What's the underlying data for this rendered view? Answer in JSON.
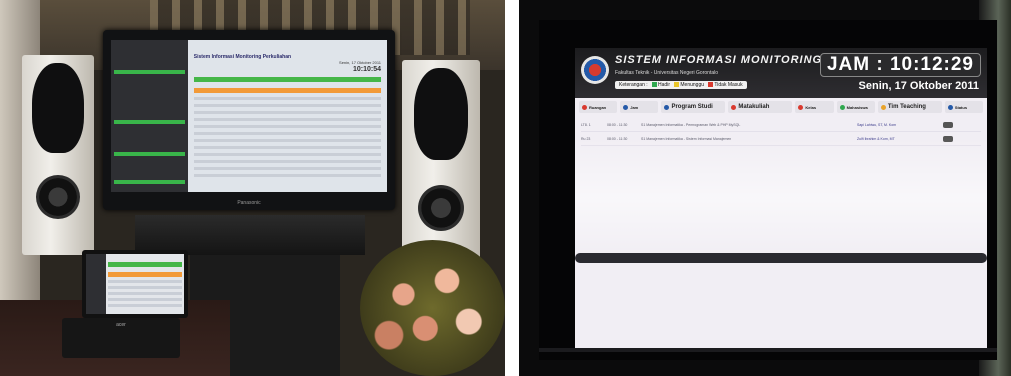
{
  "colors": {
    "header_dark": "#1c1c1e",
    "legend_green": "#2fa84f",
    "legend_yellow": "#e8c52a",
    "legend_red": "#d93a2f",
    "mini_green": "#39b54a",
    "mini_orange": "#f29a38"
  },
  "left_photo": {
    "tv": {
      "title": "Sistem Informasi Monitoring Perkuliahan",
      "date_text": "Senin, 17 Oktober 2011",
      "time": "10:10:54"
    },
    "tv_brand": "Panasonic",
    "laptop_brand": "acer"
  },
  "right_photo": {
    "app_title": "SISTEM INFORMASI MONITORING PERKULIAHAN",
    "app_subtitle": "Fakultas Teknik - Universitas Negeri Gorontalo",
    "clock": "JAM : 10:12:29",
    "date": "Senin, 17 Oktober 2011",
    "legend": {
      "label": "Keterangan :",
      "items": [
        "Hadir",
        "Menunggu",
        "Tidak Masuk"
      ]
    },
    "columns": [
      "Ruangan",
      "Jam",
      "Program Studi",
      "Matakuliah",
      "Kelas",
      "Mahasiswa",
      "Tim Teaching",
      "Status"
    ],
    "rows": [
      {
        "room": "LT8. 1",
        "time": "08:00 - 11:30",
        "course": "S1 Manajemen Informatika - Pemrograman Web & PHP MySQL",
        "class": "",
        "students": "",
        "teachers": "Sapi Lahiwu, ST, M. Kom"
      },
      {
        "room": "Ru 23",
        "time": "08:00 - 11:30",
        "course": "S1 Manajemen Informatika - Sistem Informasi Manajemen",
        "class": "",
        "students": "",
        "teachers": "Zulfi Ibrahim & Kom, MT"
      }
    ]
  }
}
